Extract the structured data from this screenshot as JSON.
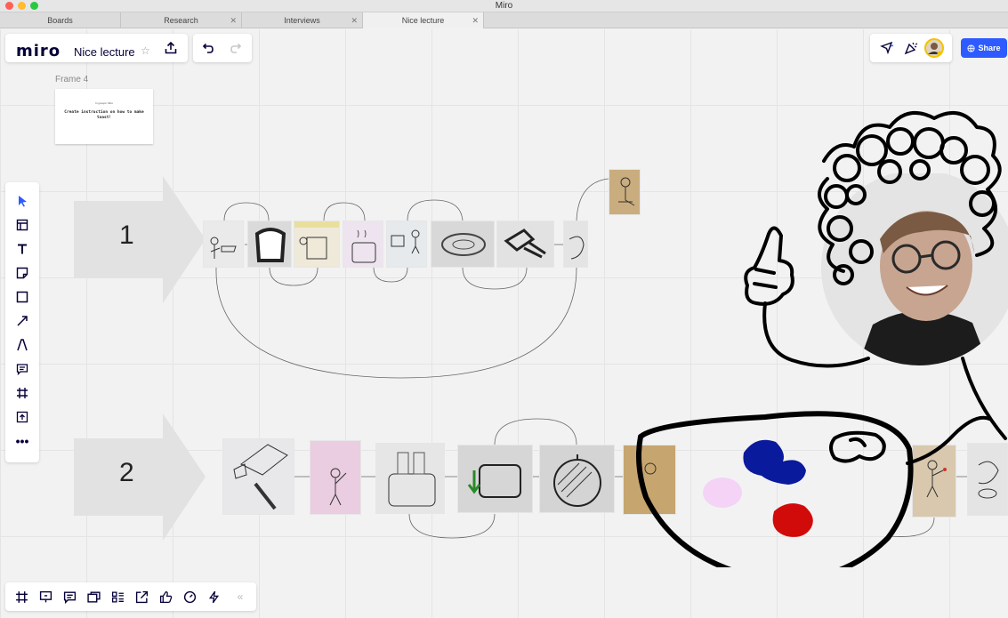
{
  "window": {
    "title": "Miro"
  },
  "tabs": [
    {
      "label": "Boards",
      "closable": false
    },
    {
      "label": "Research",
      "closable": true
    },
    {
      "label": "Interviews",
      "closable": true
    },
    {
      "label": "Nice lecture",
      "closable": true,
      "active": true
    }
  ],
  "header": {
    "logo": "miro",
    "board_name": "Nice lecture"
  },
  "frame": {
    "label": "Frame 4",
    "small_text": "In groups: Miro",
    "text": "Create instruction on how to make toast!"
  },
  "rows": [
    {
      "number": "1"
    },
    {
      "number": "2"
    }
  ],
  "toolbar": [
    "select-tool",
    "templates-tool",
    "text-tool",
    "sticky-note-tool",
    "shape-tool",
    "connection-line-tool",
    "pen-tool",
    "comment-tool",
    "frame-tool",
    "upload-tool",
    "more-tools"
  ],
  "bottom_toolbar": [
    "frames",
    "presentation",
    "comments",
    "cards",
    "kanban",
    "embed",
    "voting",
    "timer",
    "integrations",
    "collapse"
  ],
  "share": {
    "label": "Share"
  },
  "colors": {
    "accent": "#2d5bff",
    "palette_blue": "#0a1a9c",
    "palette_red": "#d10a0a",
    "palette_pink": "#f4d3f7"
  }
}
